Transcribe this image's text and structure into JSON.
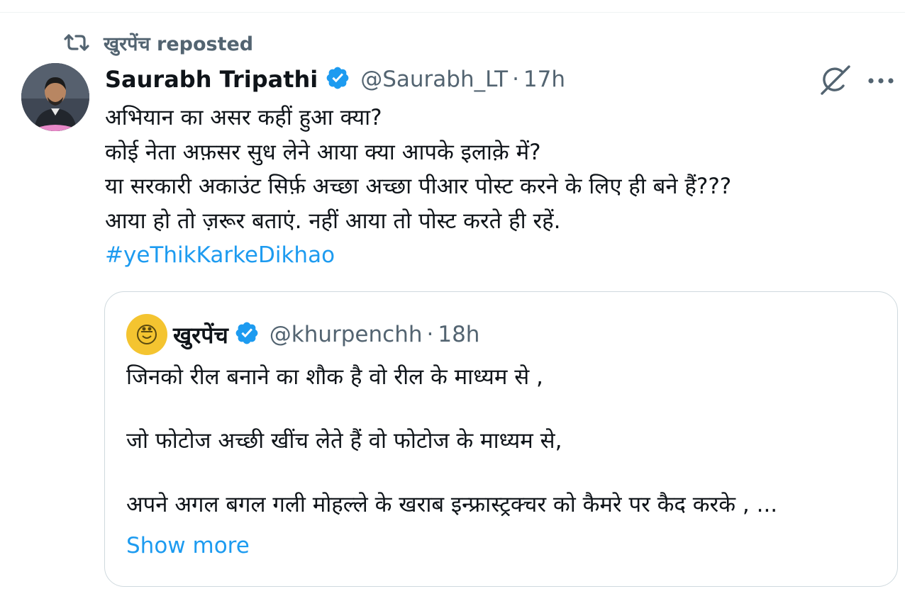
{
  "repost": {
    "icon": "repost-icon",
    "text": "खुरपेंच reposted"
  },
  "tweet": {
    "author_name": "Saurabh Tripathi",
    "verified": true,
    "handle": "@Saurabh_LT",
    "separator": "·",
    "time": "17h",
    "text_lines": [
      "अभियान का असर कहीं हुआ क्या?",
      "कोई नेता अफ़सर सुध लेने आया क्या आपके इलाक़े में?",
      "या सरकारी अकाउंट सिर्फ़ अच्छा अच्छा पीआर पोस्ट करने के लिए ही बने हैं???",
      "आया हो तो ज़रूर बताएं. नहीं आया तो पोस्ट करते ही रहें."
    ],
    "hashtag": "#yeThikKarkeDikhao",
    "actions": {
      "grok_icon": "grok-icon",
      "more_icon": "more-options-icon"
    }
  },
  "quoted": {
    "author_name": "खुरपेंच",
    "verified": true,
    "handle": "@khurpenchh",
    "separator": "·",
    "time": "18h",
    "text_lines": [
      "जिनको रील बनाने का शौक है वो रील के माध्यम से ,",
      "",
      "जो फोटोज अच्छी खींच लेते हैं वो फोटोज के माध्यम से,",
      "",
      "अपने अगल बगल गली मोहल्ले के खराब इन्फ्रास्ट्रक्चर को कैमरे पर कैद करके , ..."
    ],
    "show_more": "Show more"
  },
  "colors": {
    "accent": "#1d9bf0",
    "secondary_text": "#536471",
    "border": "#cfd9de",
    "verified": "#1d9bf0",
    "quote_avatar_bg": "#f4c430"
  }
}
